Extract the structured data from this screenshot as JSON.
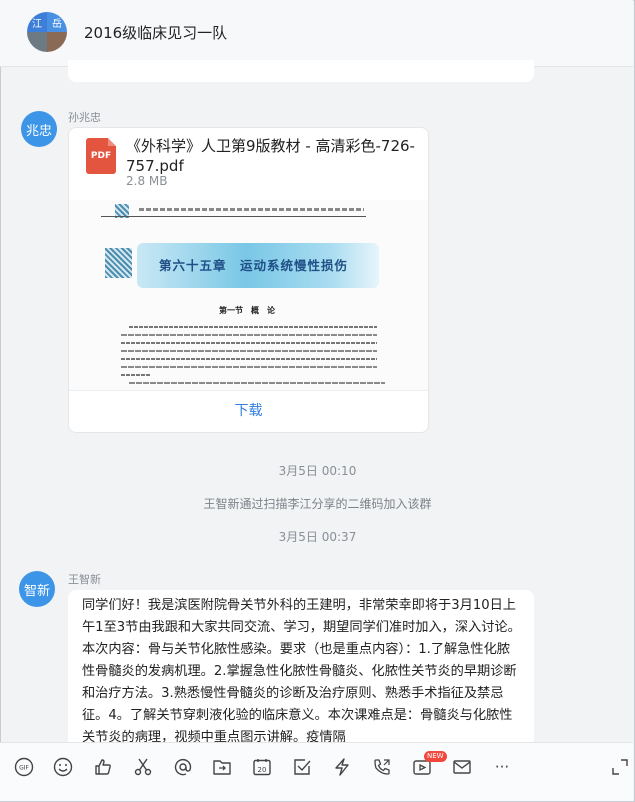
{
  "header": {
    "group_title": "2016级临床见习一队",
    "avatar_chars": [
      "江",
      "岳"
    ]
  },
  "messages": {
    "file_message": {
      "avatar_text": "兆忠",
      "sender": "孙兆忠",
      "file_name": "《外科学》人卫第9版教材 - 高清彩色-726-757.pdf",
      "file_size": "2.8 MB",
      "file_type": "PDF",
      "preview_chapter": "第六十五章　运动系统慢性损伤",
      "preview_section": "第一节　概　论",
      "download_label": "下载"
    },
    "timestamp_1": "3月5日 00:10",
    "system_notice": "王智新通过扫描李江分享的二维码加入该群",
    "timestamp_2": "3月5日 00:37",
    "text_message": {
      "avatar_text": "智新",
      "sender": "王智新",
      "text": "同学们好！我是滨医附院骨关节外科的王建明，非常荣幸即将于3月10日上午1至3节由我跟和大家共同交流、学习，期望同学们准时加入，深入讨论。本次内容：骨与关节化脓性感染。要求（也是重点内容）：1.了解急性化脓性骨髓炎的发病机理。2.掌握急性化脓性骨髓炎、化脓性关节炎的早期诊断和治疗方法。3.熟悉慢性骨髓炎的诊断及治疗原则、熟悉手术指征及禁忌征。4。了解关节穿刺液化验的临床意义。本次课难点是：骨髓炎与化脓性关节炎的病理，视频中重点图示讲解。疫情隔"
    }
  },
  "toolbar": {
    "gif_label": "GIF",
    "calendar_label": "20",
    "new_badge": "NEW",
    "more_label": "···"
  },
  "colors": {
    "avatar_blue": "#3d95e8",
    "link_blue": "#2f7fe0",
    "pdf_red": "#e4553f",
    "badge_red": "#f0483e"
  }
}
